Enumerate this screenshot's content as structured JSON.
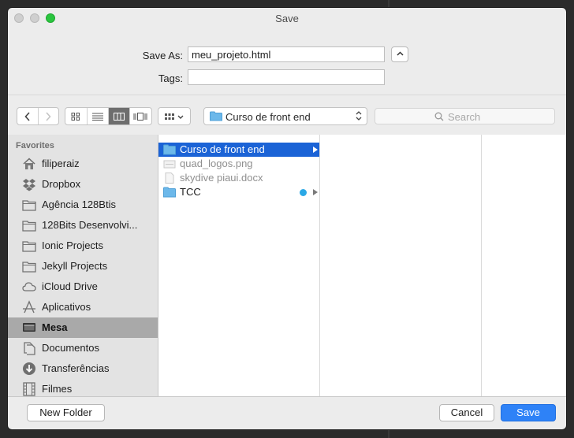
{
  "window": {
    "title": "Save"
  },
  "save_as": {
    "label": "Save As:",
    "value": "meu_projeto.html"
  },
  "tags": {
    "label": "Tags:",
    "value": ""
  },
  "toolbar": {
    "view_modes": [
      "icon-view",
      "list-view",
      "column-view",
      "coverflow-view"
    ],
    "active_view": "column-view",
    "location": "Curso de front end",
    "search_placeholder": "Search"
  },
  "sidebar": {
    "heading": "Favorites",
    "items": [
      {
        "label": "filiperaiz",
        "icon": "home-icon"
      },
      {
        "label": "Dropbox",
        "icon": "dropbox-icon"
      },
      {
        "label": "Agência 128Btis",
        "icon": "folder-icon"
      },
      {
        "label": "128Bits Desenvolvi...",
        "icon": "folder-icon"
      },
      {
        "label": "Ionic Projects",
        "icon": "folder-icon"
      },
      {
        "label": "Jekyll Projects",
        "icon": "folder-icon"
      },
      {
        "label": "iCloud Drive",
        "icon": "cloud-icon"
      },
      {
        "label": "Aplicativos",
        "icon": "applications-icon"
      },
      {
        "label": "Mesa",
        "icon": "desktop-icon",
        "selected": true
      },
      {
        "label": "Documentos",
        "icon": "documents-icon"
      },
      {
        "label": "Transferências",
        "icon": "downloads-icon"
      },
      {
        "label": "Filmes",
        "icon": "movies-icon"
      }
    ]
  },
  "files": [
    {
      "name": "Curso de front end",
      "type": "folder",
      "selected": true
    },
    {
      "name": "quad_logos.png",
      "type": "file",
      "dim": true
    },
    {
      "name": "skydive piaui.docx",
      "type": "file",
      "dim": true
    },
    {
      "name": "TCC",
      "type": "folder",
      "tag_color": "#2aa8e6"
    }
  ],
  "buttons": {
    "new_folder": "New Folder",
    "cancel": "Cancel",
    "save": "Save"
  },
  "colors": {
    "accent": "#2e82f7",
    "selection": "#1b63d6",
    "folder": "#6cb8ea"
  }
}
